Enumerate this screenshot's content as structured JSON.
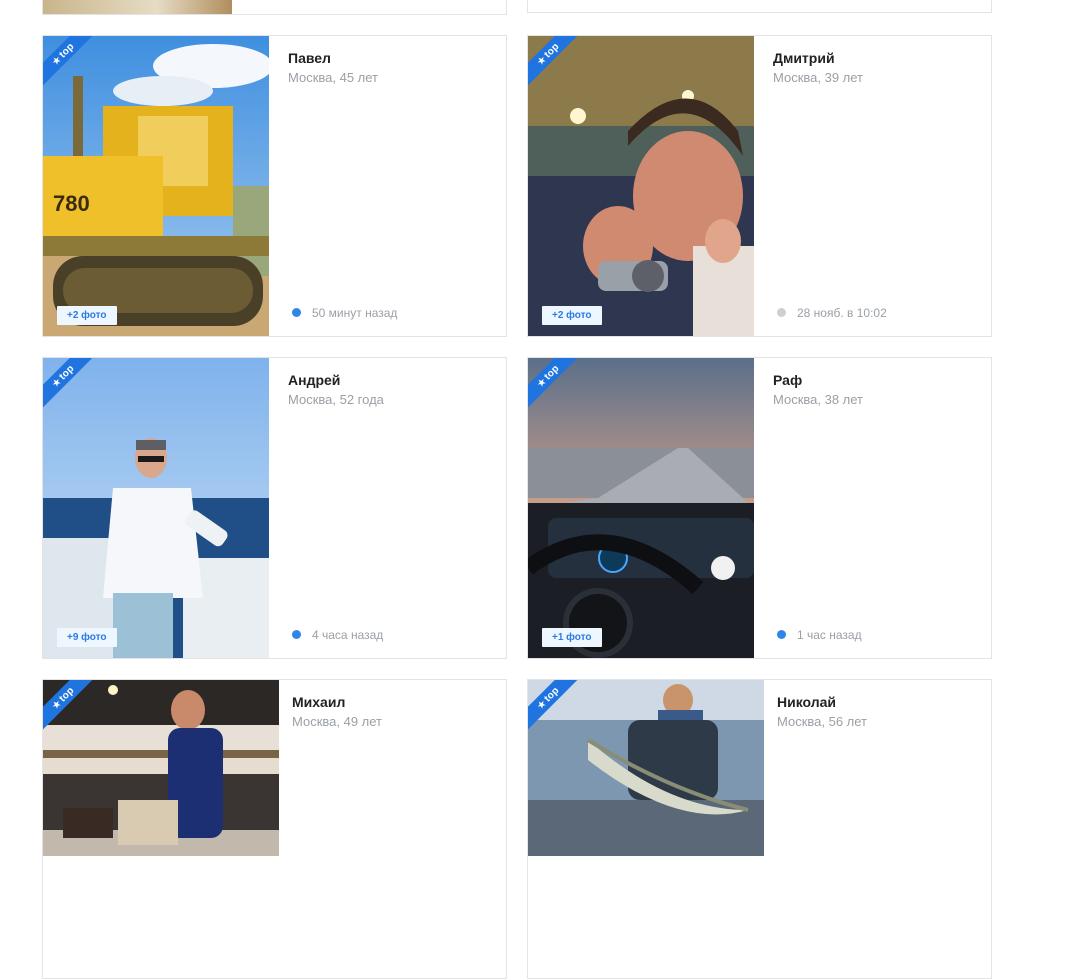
{
  "colors": {
    "accent": "#1f74e0",
    "online": "#2f86ea",
    "offline": "#cfcfcf"
  },
  "badge_label": "top",
  "profiles": [
    {
      "name": "Павел",
      "location": "Москва, 45 лет",
      "photos": "+2 фото",
      "status": "50 минут назад",
      "online": true
    },
    {
      "name": "Дмитрий",
      "location": "Москва, 39 лет",
      "photos": "+2 фото",
      "status": "28 нояб. в 10:02",
      "online": false
    },
    {
      "name": "Андрей",
      "location": "Москва, 52 года",
      "photos": "+9 фото",
      "status": "4 часа назад",
      "online": true
    },
    {
      "name": "Раф",
      "location": "Москва, 38 лет",
      "photos": "+1 фото",
      "status": "1 час назад",
      "online": true
    },
    {
      "name": "Михаил",
      "location": "Москва, 49 лет"
    },
    {
      "name": "Николай",
      "location": "Москва, 56 лет"
    }
  ]
}
